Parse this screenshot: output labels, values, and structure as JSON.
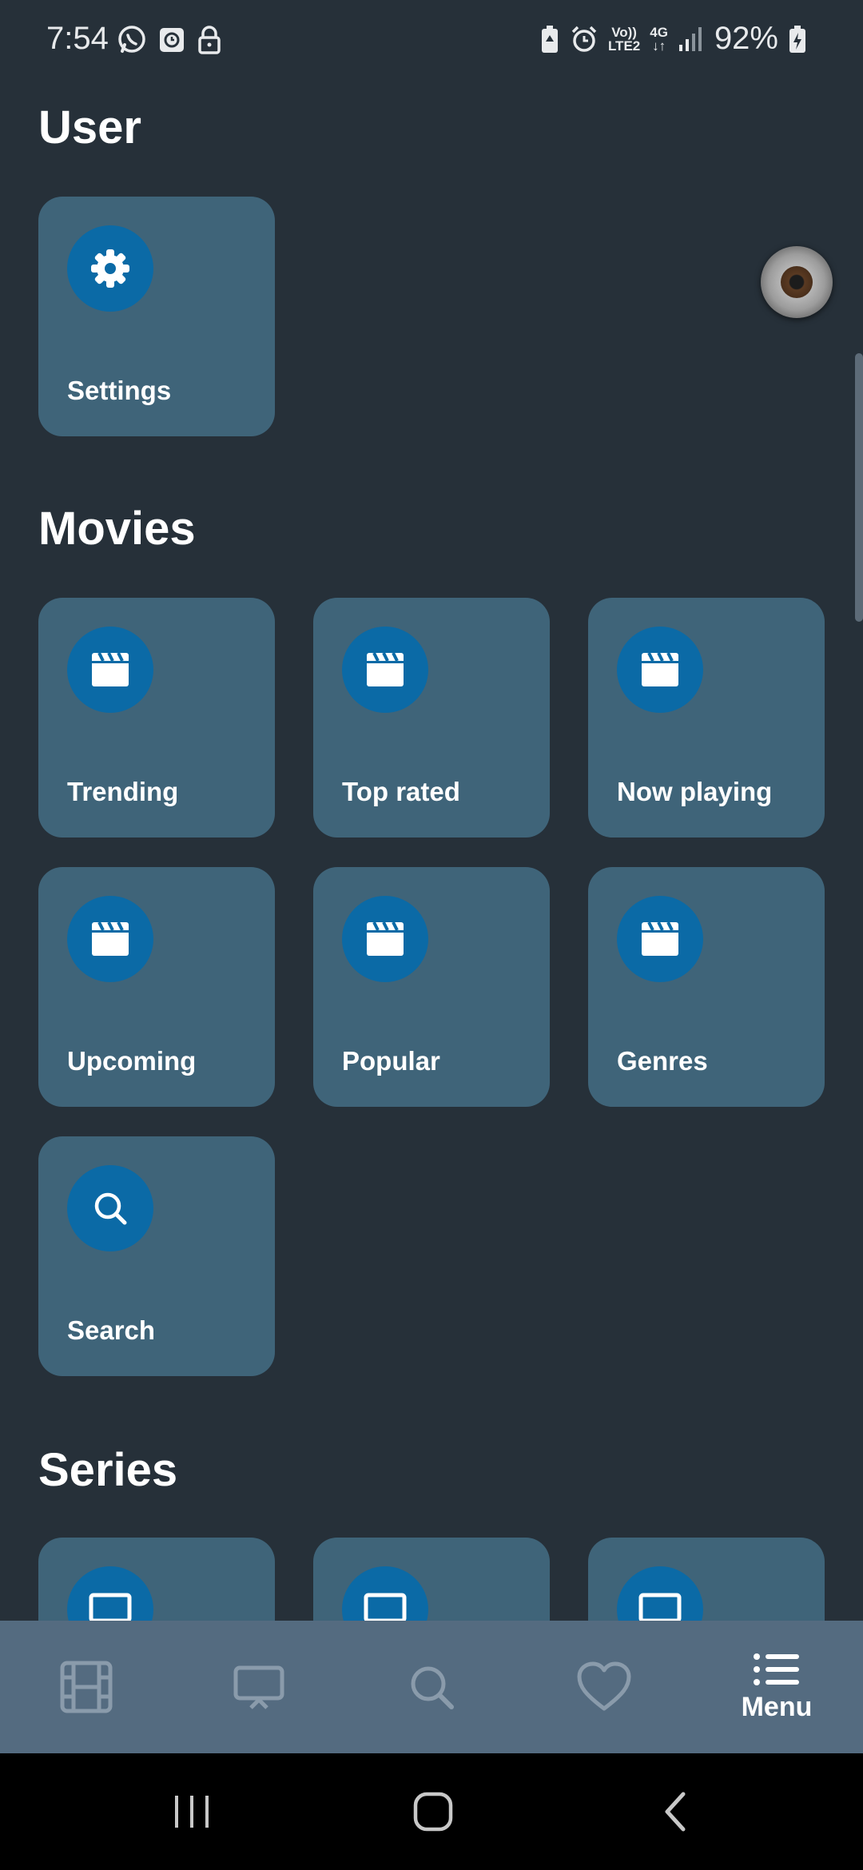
{
  "status_bar": {
    "time": "7:54",
    "network_top": "Vo))",
    "network_bottom": "LTE2",
    "signal_type": "4G",
    "battery": "92%"
  },
  "sections": {
    "user": {
      "title": "User",
      "tiles": [
        {
          "label": "Settings",
          "icon": "gear-icon"
        }
      ]
    },
    "movies": {
      "title": "Movies",
      "tiles": [
        {
          "label": "Trending",
          "icon": "clapperboard-icon"
        },
        {
          "label": "Top rated",
          "icon": "clapperboard-icon"
        },
        {
          "label": "Now playing",
          "icon": "clapperboard-icon"
        },
        {
          "label": "Upcoming",
          "icon": "clapperboard-icon"
        },
        {
          "label": "Popular",
          "icon": "clapperboard-icon"
        },
        {
          "label": "Genres",
          "icon": "clapperboard-icon"
        },
        {
          "label": "Search",
          "icon": "search-icon"
        }
      ]
    },
    "series": {
      "title": "Series",
      "tiles": [
        {
          "icon": "tv-icon"
        },
        {
          "icon": "tv-icon"
        },
        {
          "icon": "tv-icon"
        }
      ]
    }
  },
  "bottom_nav": {
    "items": [
      {
        "icon": "film-icon"
      },
      {
        "icon": "tv-icon"
      },
      {
        "icon": "search-icon"
      },
      {
        "icon": "heart-icon"
      },
      {
        "icon": "menu-list-icon",
        "label": "Menu",
        "active": true
      }
    ]
  },
  "colors": {
    "background": "#263039",
    "tile": "#3f6479",
    "icon_circle": "#0b6aa6",
    "bottom_nav": "#546b80"
  }
}
